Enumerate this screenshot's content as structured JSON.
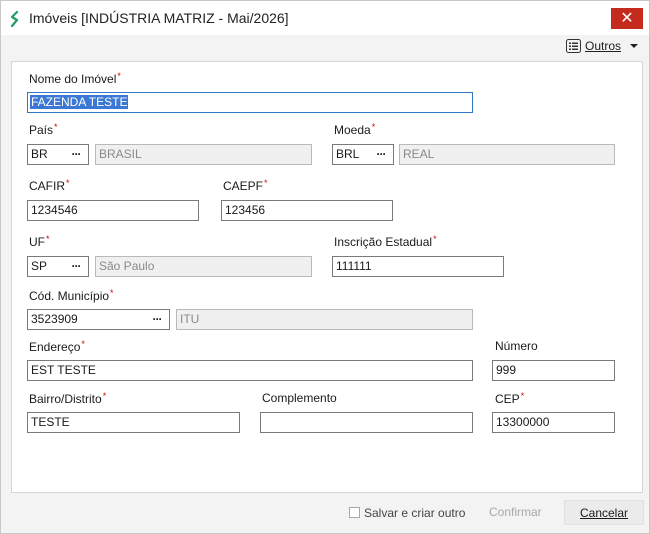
{
  "window": {
    "title": "Imóveis [INDÚSTRIA MATRIZ - Mai/2026]",
    "close_glyph": "✕",
    "app_icon": "app-logo-icon"
  },
  "toolbar": {
    "outros_label": "Outros",
    "outros_icon": "list-icon",
    "dropdown_icon": "caret-down-icon"
  },
  "form": {
    "nome": {
      "label": "Nome do Imóvel",
      "value": "FAZENDA TESTE"
    },
    "pais": {
      "label": "País",
      "code": "BR",
      "name": "BRASIL"
    },
    "moeda": {
      "label": "Moeda",
      "code": "BRL",
      "name": "REAL"
    },
    "cafir": {
      "label": "CAFIR",
      "value": "1234546"
    },
    "caepf": {
      "label": "CAEPF",
      "value": "123456"
    },
    "uf": {
      "label": "UF",
      "code": "SP",
      "name": "São Paulo"
    },
    "inscricao": {
      "label": "Inscrição Estadual",
      "value": "111111"
    },
    "municipio": {
      "label": "Cód. Município",
      "code": "3523909",
      "name": "ITU"
    },
    "endereco": {
      "label": "Endereço",
      "value": "EST TESTE"
    },
    "numero": {
      "label": "Número",
      "value": "999"
    },
    "bairro": {
      "label": "Bairro/Distrito",
      "value": "TESTE"
    },
    "complemento": {
      "label": "Complemento",
      "value": ""
    },
    "cep": {
      "label": "CEP",
      "value": "13300000"
    },
    "required_mark": "*",
    "lookup_glyph": "···"
  },
  "footer": {
    "salvar_label": "Salvar e criar outro",
    "confirmar_label": "Confirmar",
    "cancelar_label": "Cancelar"
  },
  "colors": {
    "required": "#d40000",
    "close_button": "#c42b1c",
    "focus_border": "#2f77c5",
    "selection": "#3b78d5"
  }
}
